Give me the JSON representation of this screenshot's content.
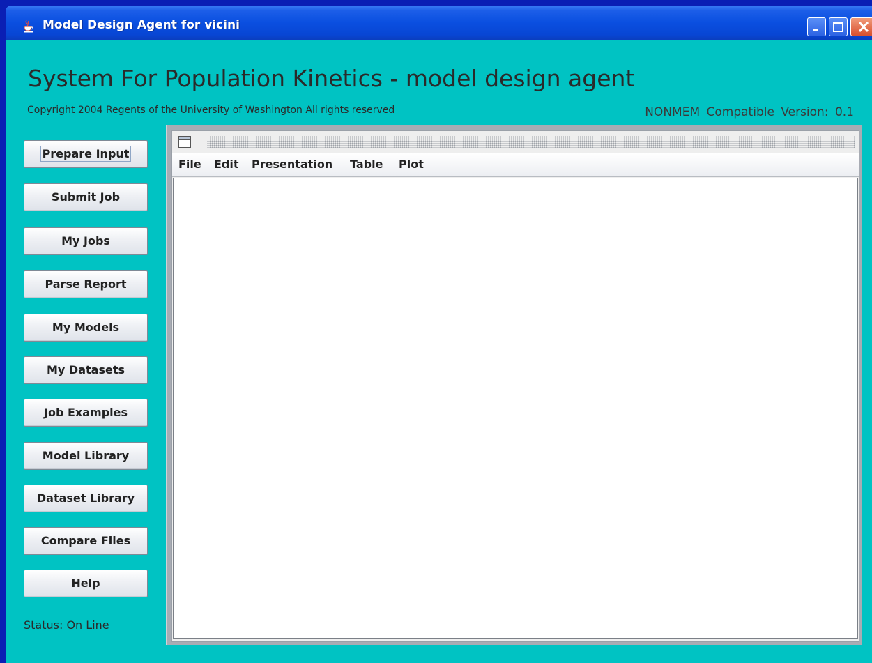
{
  "window": {
    "title": "Model Design Agent for vicini",
    "controls": [
      "minimize-icon",
      "maximize-icon",
      "close-icon"
    ]
  },
  "header": {
    "heading": "System For Population Kinetics - model design agent",
    "copyright": "Copyright 2004 Regents of the University of Washington All rights reserved",
    "version": "NONMEM Compatible Version: 0.1"
  },
  "sidebar": {
    "buttons": [
      {
        "label": "Prepare Input"
      },
      {
        "label": "Submit Job"
      },
      {
        "label": "My Jobs"
      },
      {
        "label": "Parse Report"
      },
      {
        "label": "My Models"
      },
      {
        "label": "My Datasets"
      },
      {
        "label": "Job Examples"
      },
      {
        "label": "Model Library"
      },
      {
        "label": "Dataset Library"
      },
      {
        "label": "Compare Files"
      },
      {
        "label": "Help"
      }
    ]
  },
  "status": {
    "text": "Status:  On Line"
  },
  "internal_frame": {
    "icon": "window-icon",
    "menu": [
      {
        "label": "File"
      },
      {
        "label": "Edit"
      },
      {
        "label": "Presentation"
      },
      {
        "label": "Table"
      },
      {
        "label": "Plot"
      }
    ]
  },
  "colors": {
    "background": "#00c3c3",
    "titlebar": "#0a4fe0",
    "desktop": "#a8acb4"
  }
}
